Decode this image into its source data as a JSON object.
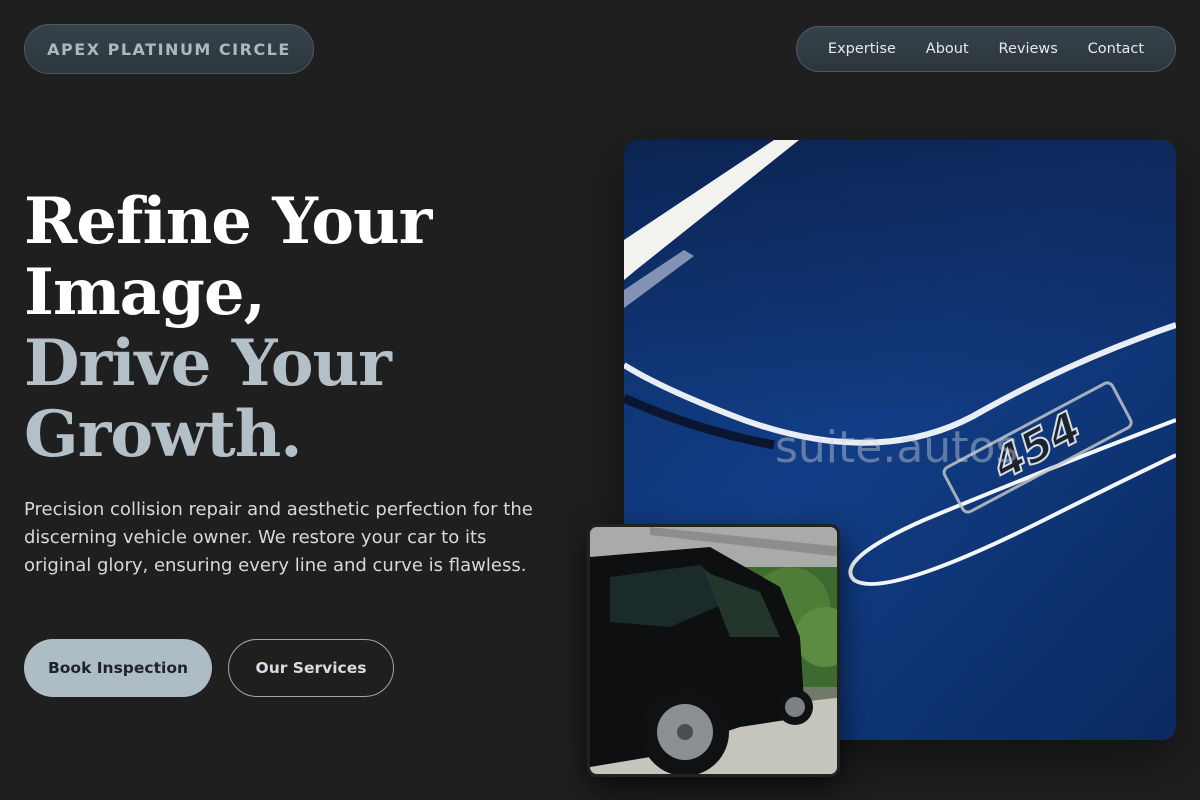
{
  "brand": {
    "name": "APEX PLATINUM CIRCLE"
  },
  "nav": {
    "items": [
      {
        "label": "Expertise"
      },
      {
        "label": "About"
      },
      {
        "label": "Reviews"
      },
      {
        "label": "Contact"
      }
    ]
  },
  "hero": {
    "title_line1": "Refine Your",
    "title_line2": "Image,",
    "title_line3": "Drive Your",
    "title_line4": "Growth.",
    "description": "Precision collision repair and aesthetic perfection for the discerning vehicle owner. We restore your car to its original glory, ensuring every line and curve is flawless.",
    "primary_button": "Book Inspection",
    "secondary_button": "Our Services"
  },
  "images": {
    "main_watermark": "suite.autos",
    "main_badge": "454"
  },
  "colors": {
    "background": "#1f1f20",
    "accent": "#aebcc6",
    "pill_bg": "#323e46",
    "title_white": "#ffffff",
    "title_gray": "#b4c0c8"
  }
}
